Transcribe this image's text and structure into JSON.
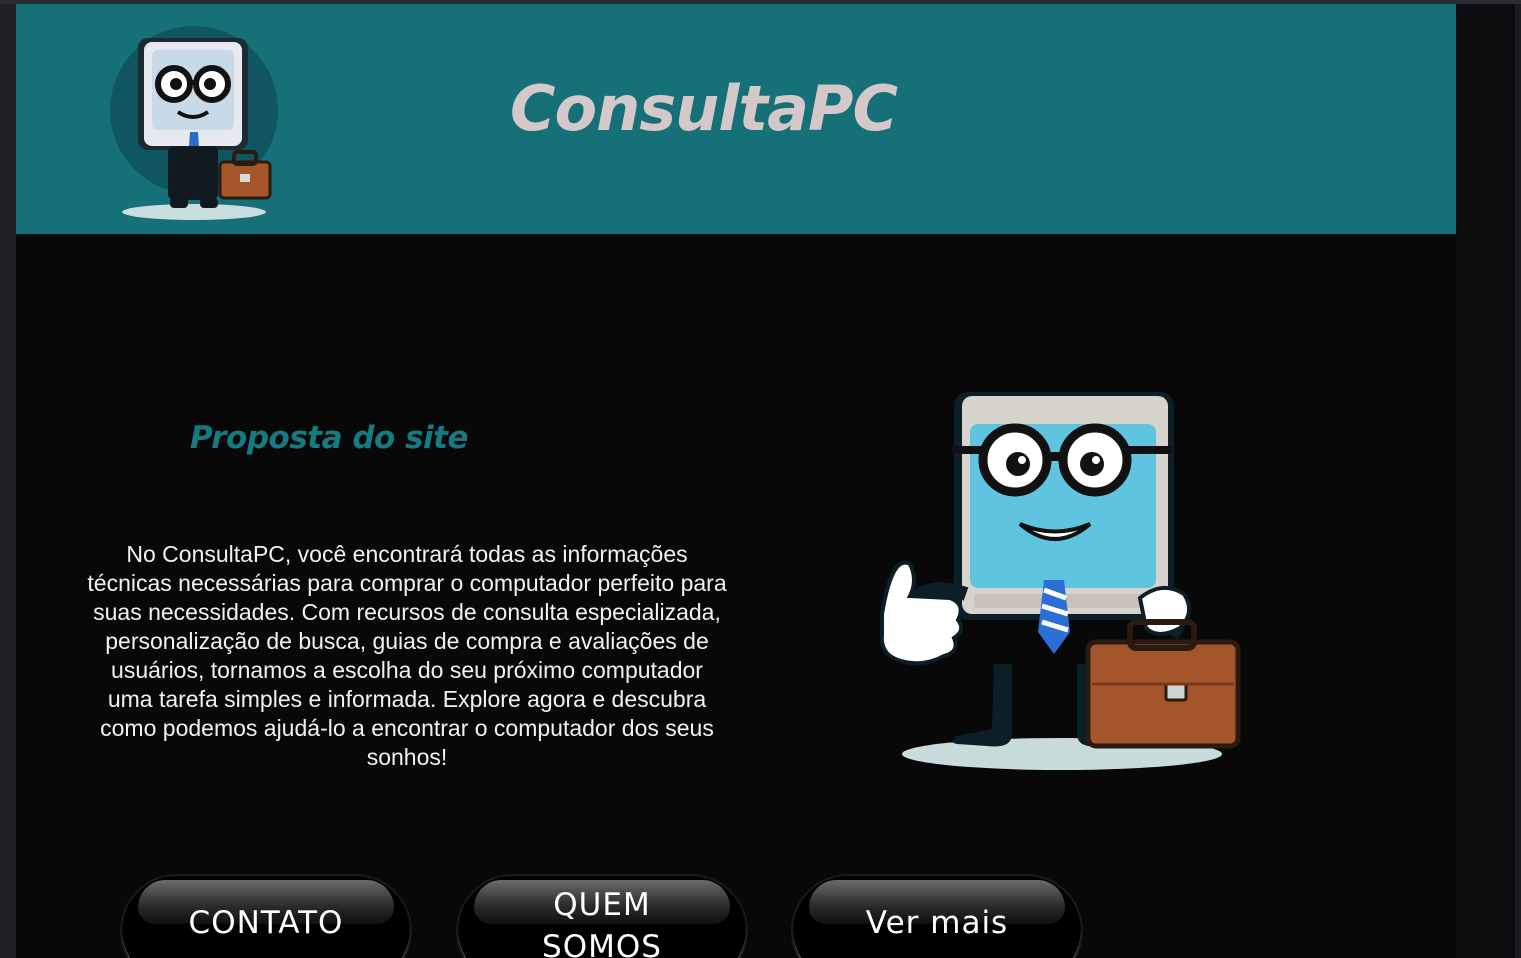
{
  "header": {
    "brand": "ConsultaPC",
    "logo_icon": "computer-mascot-icon"
  },
  "proposta": {
    "title": "Proposta do site",
    "text": "No ConsultaPC, você encontrará todas as informações técnicas necessárias para comprar o computador perfeito para suas necessidades. Com recursos de consulta especializada, personalização de busca, guias de compra e avaliações de usuários, tornamos a escolha do seu próximo computador uma tarefa simples e informada. Explore agora e descubra como podemos ajudá-lo a encontrar o computador dos seus sonhos!"
  },
  "mascot_icon": "computer-mascot-thumbs-up-icon",
  "buttons": {
    "contato": "CONTATO",
    "quem_somos_line1": "QUEM",
    "quem_somos_line2": "SOMOS",
    "ver_mais": "Ver mais"
  },
  "colors": {
    "header_bg": "#157077",
    "brand_text": "#d4c8c8",
    "section_title": "#177a82",
    "page_bg": "#080808"
  }
}
